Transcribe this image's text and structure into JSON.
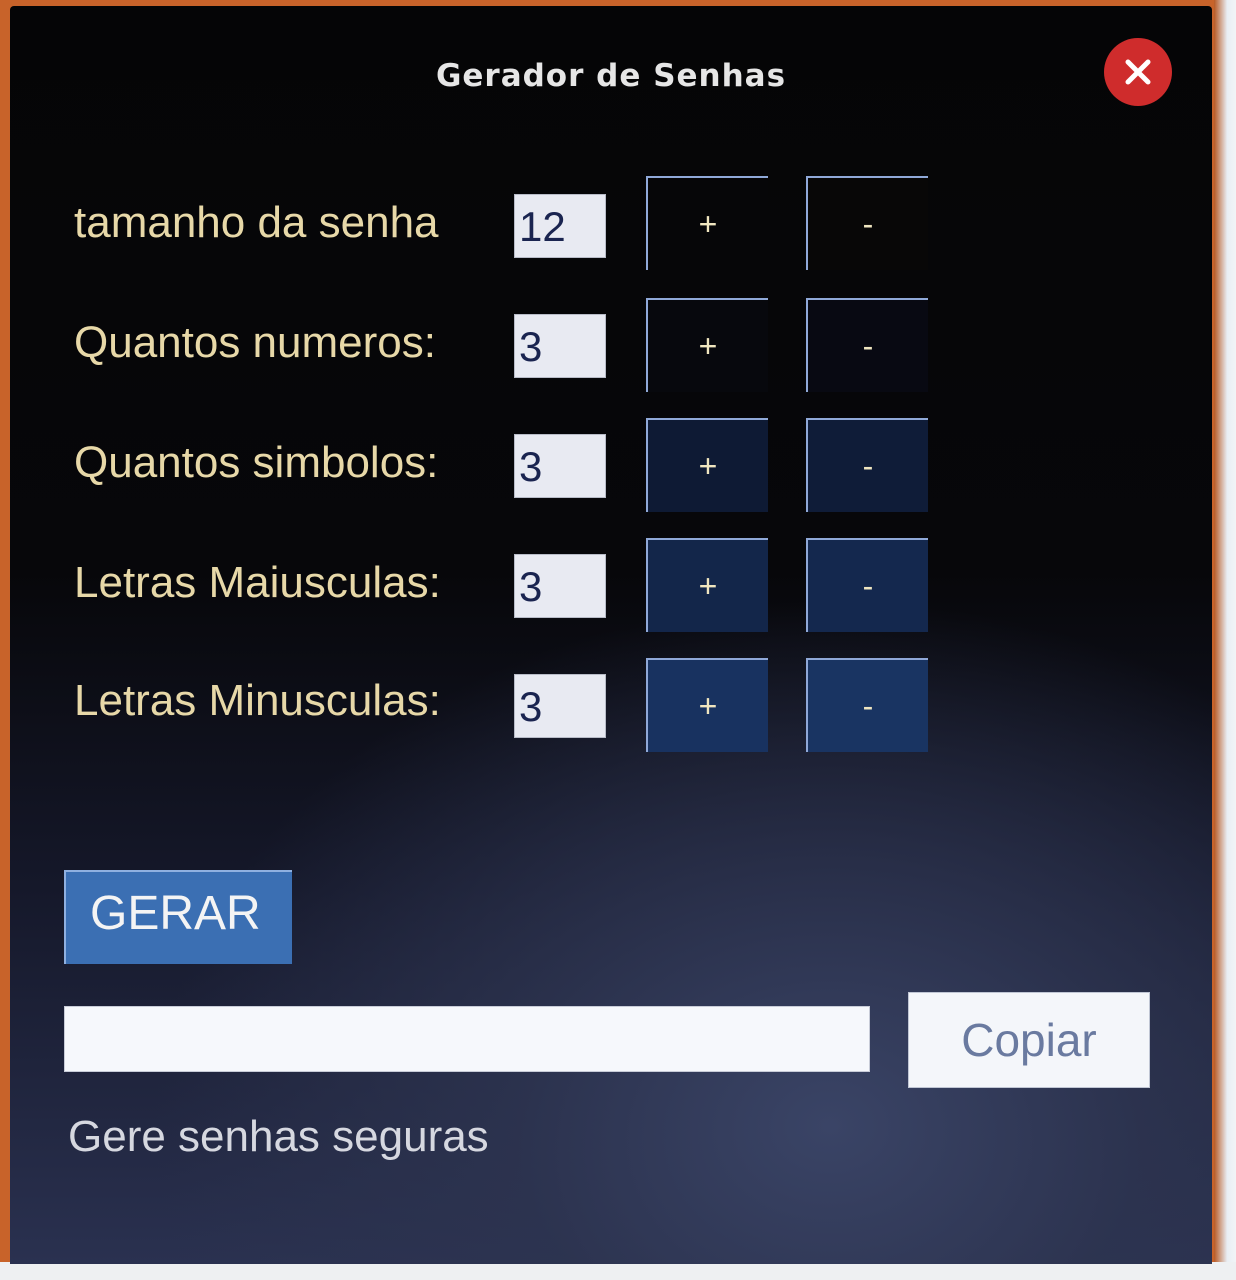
{
  "window": {
    "title": "Gerador de Senhas"
  },
  "rows": [
    {
      "label": "tamanho da senha",
      "value": "12",
      "plus": "+",
      "minus": "-"
    },
    {
      "label": "Quantos numeros:",
      "value": "3",
      "plus": "+",
      "minus": "-"
    },
    {
      "label": "Quantos simbolos:",
      "value": "3",
      "plus": "+",
      "minus": "-"
    },
    {
      "label": "Letras Maiusculas:",
      "value": "3",
      "plus": "+",
      "minus": "-"
    },
    {
      "label": "Letras Minusculas:",
      "value": "3",
      "plus": "+",
      "minus": "-"
    }
  ],
  "actions": {
    "generate_label": "GERAR",
    "copy_label": "Copiar",
    "output_value": ""
  },
  "status_text": "Gere senhas seguras",
  "colors": {
    "close_button": "#cf2c2c",
    "generate_button": "#3b6fb3",
    "label_text": "#e7d8a8"
  },
  "icons": {
    "close": "close-icon"
  }
}
